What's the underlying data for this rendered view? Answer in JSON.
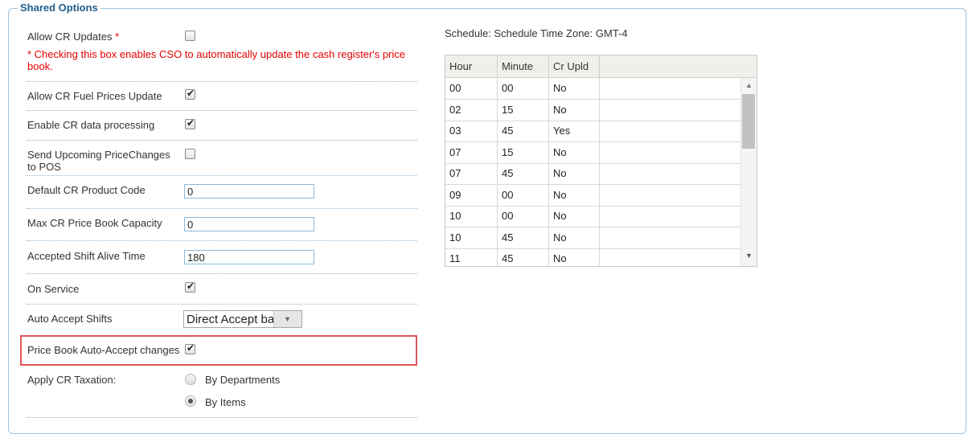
{
  "legend": "Shared Options",
  "options": {
    "allow_cr_updates": {
      "label": "Allow CR Updates",
      "required_mark": "*",
      "checked": false,
      "note": "* Checking this box enables CSO to automatically update the cash register's price book."
    },
    "allow_fuel_prices": {
      "label": "Allow CR Fuel Prices Update",
      "checked": true
    },
    "enable_cr_data": {
      "label": "Enable CR data processing",
      "checked": true
    },
    "send_upcoming": {
      "label": "Send Upcoming PriceChanges to POS",
      "checked": false
    },
    "default_product_code": {
      "label": "Default CR Product Code",
      "value": "0"
    },
    "max_price_book": {
      "label": "Max CR Price Book Capacity",
      "value": "0"
    },
    "shift_alive_time": {
      "label": "Accepted Shift Alive Time",
      "value": "180"
    },
    "on_service": {
      "label": "On Service",
      "checked": true
    },
    "auto_accept_shifts": {
      "label": "Auto Accept Shifts",
      "value": "Direct Accept based"
    },
    "price_book_auto_accept": {
      "label": "Price Book Auto-Accept changes",
      "checked": true
    },
    "cr_taxation": {
      "label": "Apply CR Taxation:",
      "options": [
        "By Departments",
        "By Items"
      ],
      "selected": "By Items"
    }
  },
  "schedule": {
    "title": "Schedule: Schedule Time Zone: GMT-4",
    "columns": [
      "Hour",
      "Minute",
      "Cr Upld"
    ],
    "rows": [
      [
        "00",
        "00",
        "No"
      ],
      [
        "02",
        "15",
        "No"
      ],
      [
        "03",
        "45",
        "Yes"
      ],
      [
        "07",
        "15",
        "No"
      ],
      [
        "07",
        "45",
        "No"
      ],
      [
        "09",
        "00",
        "No"
      ],
      [
        "10",
        "00",
        "No"
      ],
      [
        "10",
        "45",
        "No"
      ],
      [
        "11",
        "45",
        "No"
      ]
    ]
  },
  "icons": {
    "checkmark": "✔",
    "scroll_up": "▲",
    "scroll_down": "▼",
    "dropdown": "▼"
  },
  "colors": {
    "legend": "#215e8e",
    "required": "#e60000",
    "highlight": "#e0555c",
    "border": "#9cc3df"
  }
}
